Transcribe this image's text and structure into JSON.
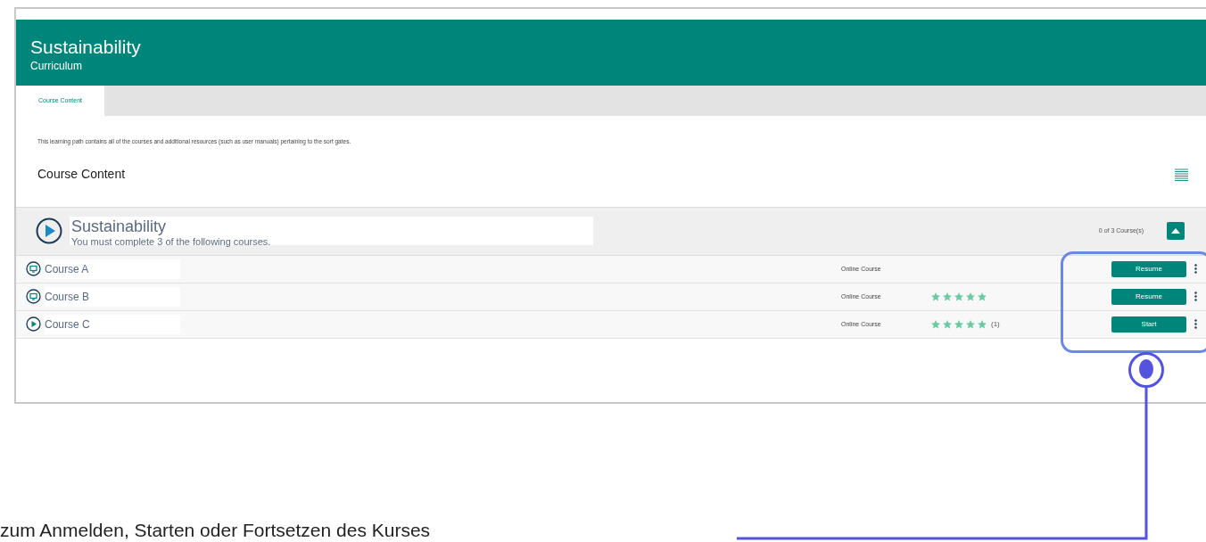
{
  "header": {
    "title": "Sustainability",
    "subtitle": "Curriculum"
  },
  "tabs": [
    {
      "label": "Course Content",
      "selected": true
    }
  ],
  "description": "This learning path contains all of the courses and additional resources (such as user manuals) pertaining to the sort gates.",
  "section_heading": "Course Content",
  "group": {
    "title": "Sustainability",
    "requirement": "You must complete 3 of the following courses.",
    "progress": "0 of 3 Course(s)",
    "expanded": true
  },
  "courses": [
    {
      "name": "Course A",
      "kind": "screen",
      "type": "Online Course",
      "action": "Resume"
    },
    {
      "name": "Course B",
      "kind": "screen",
      "type": "Online Course",
      "stars": 5,
      "action": "Resume"
    },
    {
      "name": "Course C",
      "kind": "play",
      "type": "Online Course",
      "stars": 5,
      "rating_count": "(1)",
      "action": "Start"
    }
  ],
  "annotation": {
    "caption": "zum Anmelden, Starten oder Fortsetzen des Kurses"
  }
}
